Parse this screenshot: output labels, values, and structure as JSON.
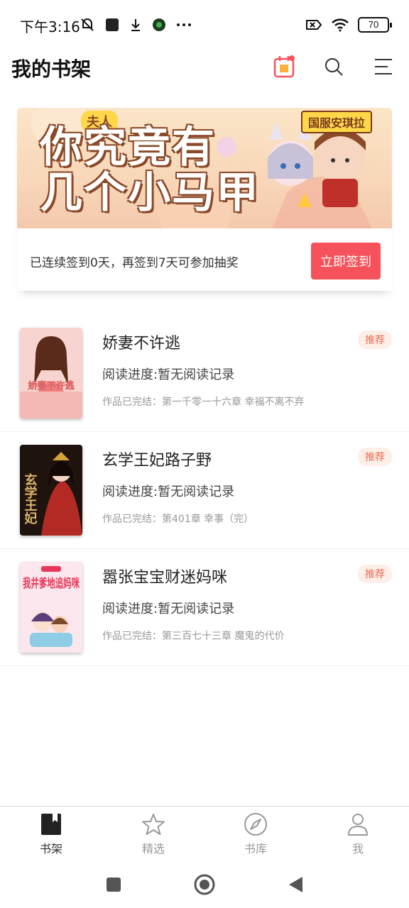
{
  "status_bar": {
    "time": "下午3:16",
    "battery": "70"
  },
  "header": {
    "title": "我的书架",
    "icons": [
      "calendar-checkin-icon",
      "search-icon",
      "menu-icon"
    ]
  },
  "banner": {
    "small_text": "夫人",
    "big_text_line1": "你究竟有",
    "big_text_line2": "几个小马甲",
    "badge": "国服安琪拉"
  },
  "signin": {
    "message": "已连续签到0天，再签到7天可参加抽奖",
    "button_label": "立即签到"
  },
  "books": [
    {
      "title": "娇妻不许逃",
      "progress": "阅读进度:暂无阅读记录",
      "status": "作品已完结：第一千零一十六章 幸福不离不弃",
      "badge": "推荐",
      "cover_text": "娇妻不许逃",
      "cover_colors": [
        "#f6c9c6",
        "#e8a7a4"
      ]
    },
    {
      "title": "玄学王妃路子野",
      "progress": "阅读进度:暂无阅读记录",
      "status": "作品已完结：第401章 幸事（完）",
      "badge": "推荐",
      "cover_text": "玄学王妃",
      "cover_colors": [
        "#2a1a14",
        "#b32a24"
      ]
    },
    {
      "title": "嚣张宝宝财迷妈咪",
      "progress": "阅读进度:暂无阅读记录",
      "status": "作品已完结：第三百七十三章 魔鬼的代价",
      "badge": "推荐",
      "cover_text": "我井爹地追妈咪",
      "cover_colors": [
        "#fde7ee",
        "#f7c3d2"
      ]
    }
  ],
  "bottom_nav": [
    {
      "label": "书架",
      "icon": "bookshelf-icon",
      "active": true
    },
    {
      "label": "精选",
      "icon": "star-icon",
      "active": false
    },
    {
      "label": "书库",
      "icon": "compass-icon",
      "active": false
    },
    {
      "label": "我",
      "icon": "profile-icon",
      "active": false
    }
  ],
  "colors": {
    "accent": "#f5525b",
    "badge_text": "#f06a4e",
    "badge_bg": "#fdeee8"
  }
}
